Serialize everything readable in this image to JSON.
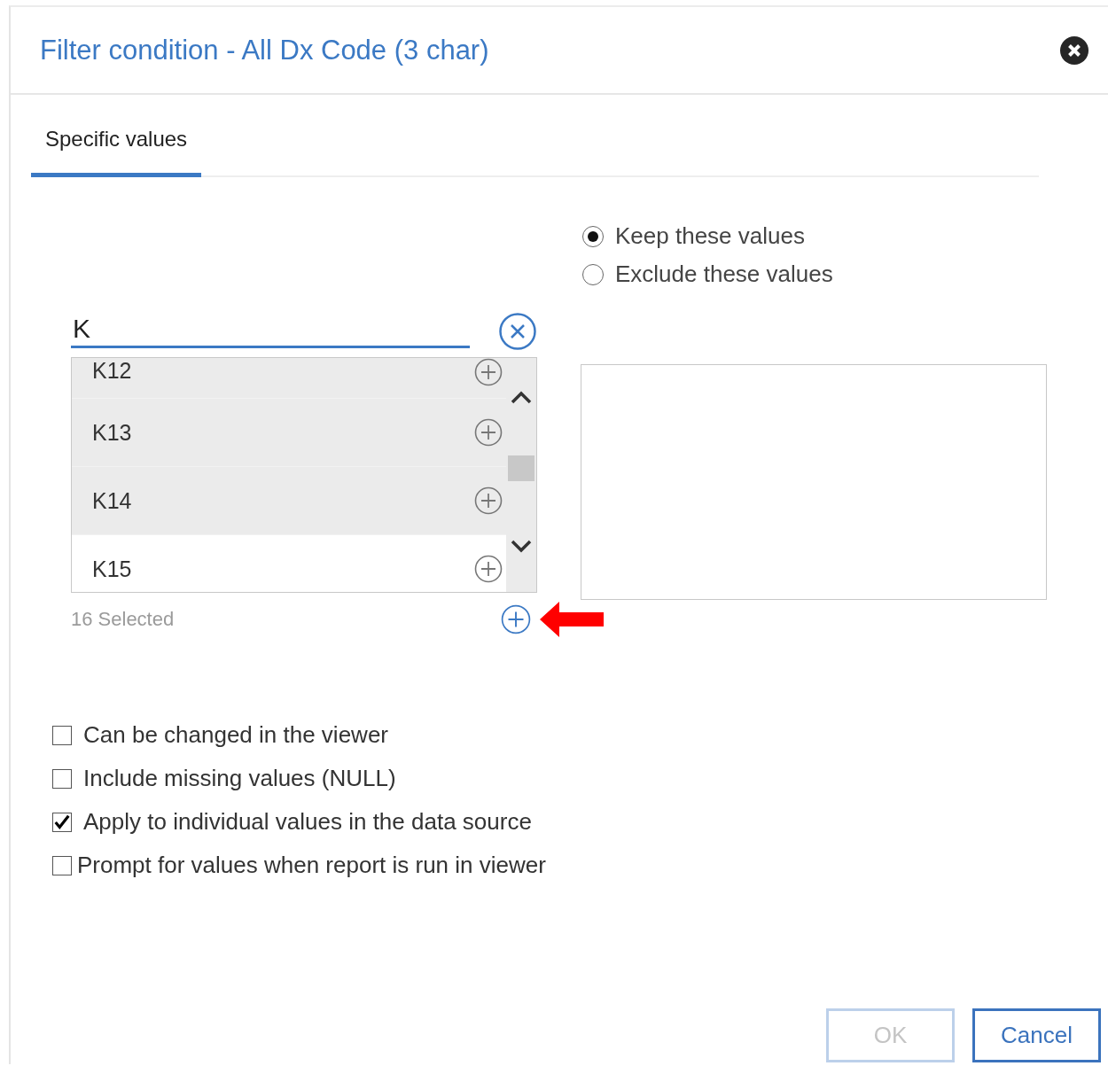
{
  "dialog": {
    "title": "Filter condition - All Dx Code (3 char)"
  },
  "tabs": [
    {
      "label": "Specific values",
      "selected": true
    }
  ],
  "mode_options": [
    {
      "label": "Keep these values",
      "selected": true
    },
    {
      "label": "Exclude these values",
      "selected": false
    }
  ],
  "search": {
    "value": "K"
  },
  "available_values": [
    {
      "label": "K12",
      "highlighted": true
    },
    {
      "label": "K13",
      "highlighted": true
    },
    {
      "label": "K14",
      "highlighted": true
    },
    {
      "label": "K15",
      "highlighted": false
    }
  ],
  "selected_count": "16 Selected",
  "options": [
    {
      "label": "Can be changed in the viewer",
      "checked": false
    },
    {
      "label": "Include missing values (NULL)",
      "checked": false
    },
    {
      "label": "Apply to individual values in the data source",
      "checked": true
    },
    {
      "label": "Prompt for values when report is run in viewer",
      "checked": false
    }
  ],
  "buttons": [
    {
      "label": "OK",
      "disabled": true
    },
    {
      "label": "Cancel",
      "disabled": false
    }
  ]
}
